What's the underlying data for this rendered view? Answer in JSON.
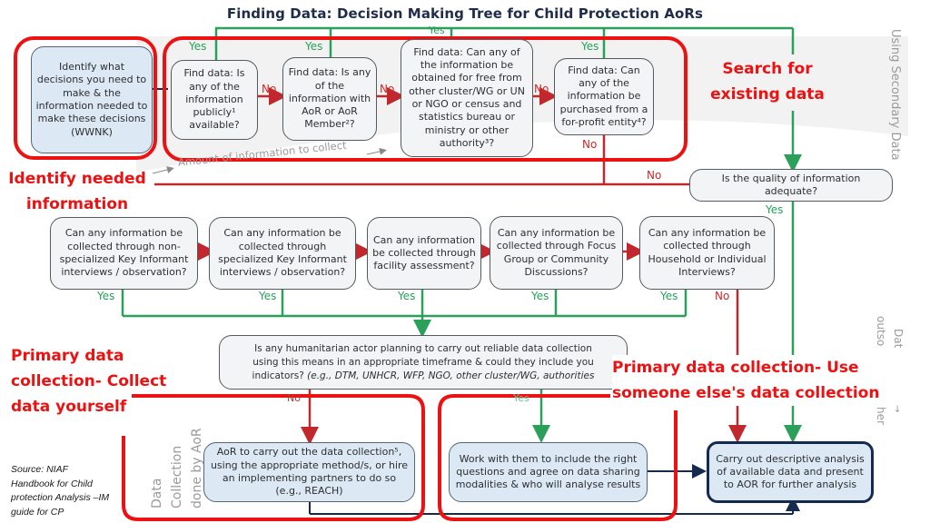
{
  "title": "Finding Data: Decision Making Tree for Child Protection AoRs",
  "side_labels": {
    "secondary": "Using Secondary Data",
    "outsourced_top": "Dat",
    "outsourced_mid": "outso",
    "outsourced_sub": "→",
    "outsourced_low": "her",
    "aor": "Data Collection done by AoR"
  },
  "annotations": {
    "identify": "Identify  needed information",
    "search": "Search for existing data",
    "primary_self": "Primary data collection- Collect data yourself",
    "primary_other": "Primary data collection- Use someone else's data collection",
    "amount": "Amount of information to collect"
  },
  "source": "Source: NIAF Handbook for Child protection Analysis –IM guide for CP",
  "nodes": {
    "wwnk": "Identify what decisions you need to make & the information needed to make these decisions (WWNK)",
    "public": "Find data: Is any of the information publicly¹ available?",
    "aor_member": "Find data: Is any of the information with AoR or AoR Member²?",
    "free": "Find data: Can any of the information be obtained for free from other cluster/WG or UN or NGO or census and statistics bureau or ministry or other authority³?",
    "purchase": "Find data: Can any of the information be purchased from a for-profit entity⁴?",
    "quality": "Is the quality of information adequate?",
    "kii_nonspec": "Can any information be collected through non-specialized Key Informant interviews / observation?",
    "kii_spec": "Can any information be collected through specialized Key Informant interviews / observation?",
    "facility": "Can any information be collected through facility assessment?",
    "fgd": "Can any information be collected through Focus Group or Community Discussions?",
    "household": "Can any information be collected through Household or Individual Interviews?",
    "humanitarian_q1": "Is any humanitarian actor planning to carry out reliable data collection",
    "humanitarian_q2": "using this means in an appropriate timeframe & could they include you",
    "humanitarian_q3a": "indicators? ",
    "humanitarian_q3b": "(e.g., DTM, UNHCR, WFP, NGO, other cluster/WG, authorities",
    "aor_collect": "AoR to carry out the data collection⁵, using the appropriate method/s, or hire an implementing partners to do so (e.g., REACH)",
    "work_with": "Work with them to include the right questions and agree on data sharing modalities & who will analyse results",
    "analysis": "Carry out descriptive analysis of available data and present to AOR for further analysis"
  },
  "edge_labels": {
    "yes": "Yes",
    "no": "No"
  },
  "colors": {
    "yes_green": "#2aa05a",
    "no_red": "#c0282d",
    "highlight_red": "#ee1111",
    "navy": "#142a4e"
  }
}
